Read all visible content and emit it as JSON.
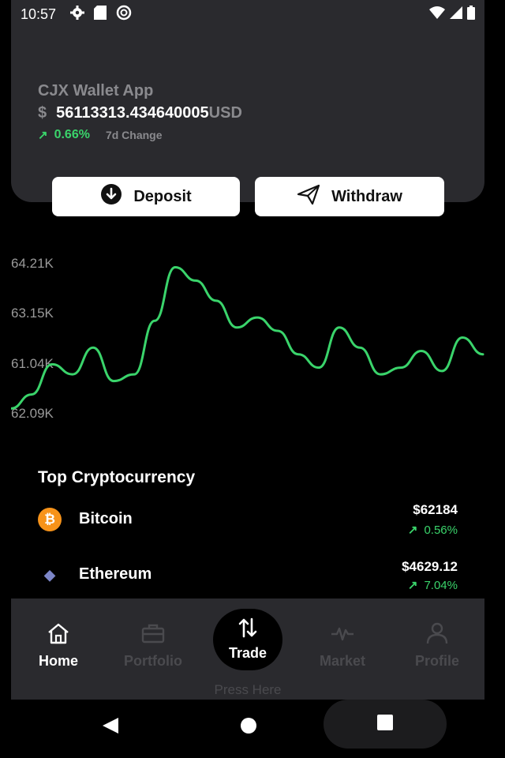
{
  "status_bar": {
    "time": "10:57",
    "left_icons": [
      "gear-icon",
      "sd-card-icon",
      "vpn-icon"
    ],
    "right_icons": [
      "wifi-icon",
      "signal-icon",
      "battery-icon"
    ]
  },
  "wallet": {
    "app_name": "CJX Wallet App",
    "currency_symbol": "$",
    "balance": "56113313.434640005",
    "unit": "USD",
    "change_arrow": "↗",
    "change_value": "0.66%",
    "change_label": "7d Change"
  },
  "actions": {
    "deposit_label": "Deposit",
    "withdraw_label": "Withdraw"
  },
  "colors": {
    "accent_green": "#3ad46b",
    "card_bg": "#2a2a2e",
    "bitcoin_orange": "#f7931a"
  },
  "chart_data": {
    "type": "line",
    "y_ticks": [
      "64.21K",
      "63.15K",
      "61.04K",
      "62.09K"
    ],
    "series": [
      {
        "values": [
          62090,
          62300,
          62750,
          62600,
          63000,
          62500,
          62600,
          63400,
          64200,
          64000,
          63700,
          63300,
          63450,
          63250,
          62900,
          62700,
          63300,
          63000,
          62600,
          62700,
          62950,
          62650,
          63150,
          62900
        ],
        "color": "#3ad46b"
      }
    ],
    "grid": false,
    "legend": "none"
  },
  "top_crypto": {
    "title": "Top Cryptocurrency",
    "coins": [
      {
        "name": "Bitcoin",
        "symbol_glyph": "₿",
        "icon": "bitcoin-icon",
        "price": "$62184",
        "change_arrow": "↗",
        "change": "0.56%"
      },
      {
        "name": "Ethereum",
        "symbol_glyph": "◆",
        "icon": "ethereum-icon",
        "price": "$4629.12",
        "change_arrow": "↗",
        "change": "7.04%"
      }
    ]
  },
  "bottom_nav": {
    "items": [
      {
        "label": "Home",
        "icon": "home-icon",
        "active": true
      },
      {
        "label": "Portfolio",
        "icon": "briefcase-icon",
        "active": false
      },
      {
        "label": "Trade",
        "icon": "swap-arrows-icon",
        "active": false
      },
      {
        "label": "Market",
        "icon": "pulse-icon",
        "active": false
      },
      {
        "label": "Profile",
        "icon": "user-icon",
        "active": false
      }
    ],
    "press_here": "Press Here"
  },
  "system_nav": [
    "back-icon",
    "home-circle-icon",
    "recents-icon"
  ]
}
